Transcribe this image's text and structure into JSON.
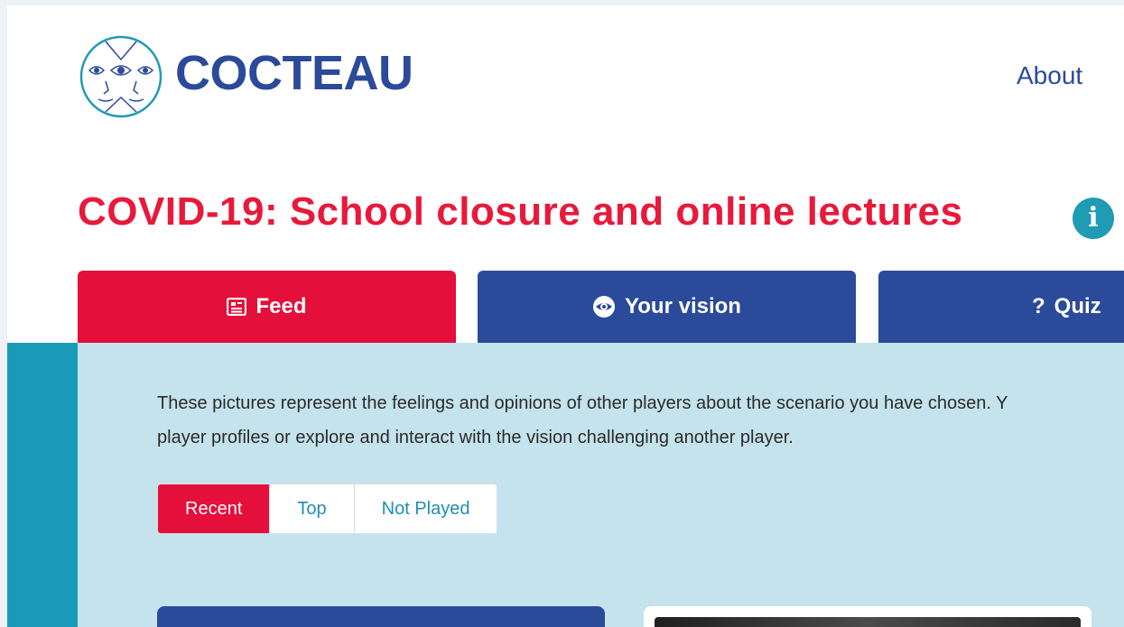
{
  "header": {
    "brand": "COCTEAU",
    "nav_about": "About"
  },
  "scenario": {
    "title": "COVID-19: School closure and online lectures"
  },
  "tabs": [
    {
      "label": "Feed",
      "icon": "newspaper-icon"
    },
    {
      "label": "Your vision",
      "icon": "eye-icon"
    },
    {
      "label": "Quiz",
      "icon": "question-icon"
    }
  ],
  "feed": {
    "description_line1": "These pictures represent the feelings and opinions of other players about the scenario you have chosen. Y",
    "description_line2": "player profiles or explore and interact with the vision challenging another player.",
    "filters": [
      "Recent",
      "Top",
      "Not Played"
    ],
    "active_filter": "Recent"
  },
  "colors": {
    "brand_blue": "#2b4a9a",
    "accent_red": "#e40f3a",
    "teal": "#1a9bb7",
    "band_bg": "#c5e3ec"
  }
}
